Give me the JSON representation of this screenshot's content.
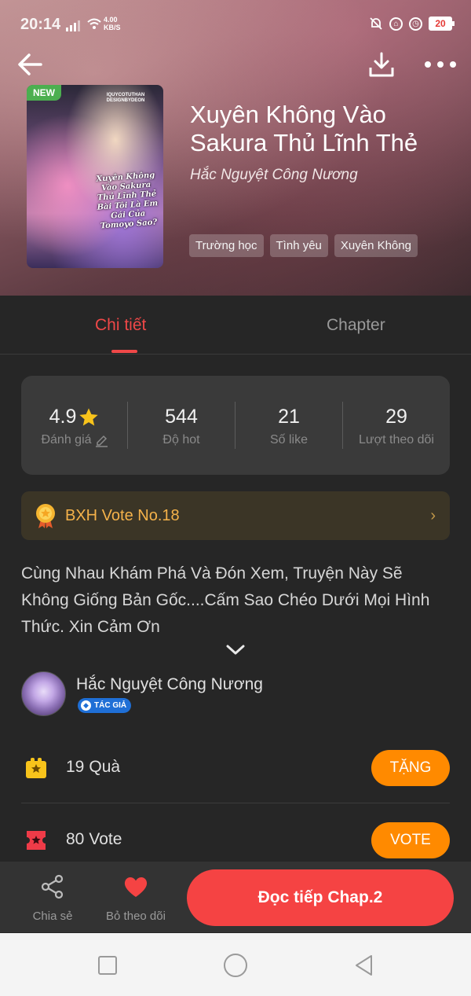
{
  "status_bar": {
    "time": "20:14",
    "net_speed_value": "4.00",
    "net_speed_unit": "KB/S",
    "battery": "20"
  },
  "header": {
    "back_icon": "arrow-left-icon",
    "download_icon": "download-icon",
    "more_icon": "more-horizontal-icon"
  },
  "book": {
    "badge_new": "NEW",
    "cover_credit": "IQUYCOTUTHAN\nDESIGNBYDEON",
    "cover_title": "Xuyên Không Vào Sakura Thủ Lĩnh Thẻ Bài Tôi Là Em Gái Của Tomoyo Sao?",
    "title": "Xuyên Không Vào Sakura Thủ Lĩnh Thẻ",
    "author": "Hắc Nguyệt Công Nương",
    "tags": [
      "Trường học",
      "Tình yêu",
      "Xuyên Không"
    ]
  },
  "tabs": {
    "details": "Chi tiết",
    "chapter": "Chapter"
  },
  "stats": [
    {
      "value": "4.9",
      "label": "Đánh giá"
    },
    {
      "value": "544",
      "label": "Độ hot"
    },
    {
      "value": "21",
      "label": "Số like"
    },
    {
      "value": "29",
      "label": "Lượt theo dõi"
    }
  ],
  "ranking": {
    "text": "BXH Vote No.18"
  },
  "description": "Cùng Nhau Khám Phá Và Đón Xem, Truyện Này Sẽ Không Giống Bản Gốc....Cấm Sao Chéo Dưới Mọi Hình Thức. Xin Cảm Ơn",
  "author_block": {
    "name": "Hắc Nguyệt Công Nương",
    "badge": "TÁC GIẢ"
  },
  "gifts": {
    "count": "19",
    "unit": "Quà",
    "button": "TẶNG"
  },
  "votes": {
    "count": "80",
    "unit": "Vote",
    "button": "VOTE"
  },
  "bottom_bar": {
    "share": "Chia sẻ",
    "unfollow": "Bỏ theo dõi",
    "read_continue": "Đọc tiếp Chap.2"
  },
  "colors": {
    "accent_red": "#f04848",
    "orange_button": "#ff8a00",
    "ranking_text": "#f5b24a"
  }
}
